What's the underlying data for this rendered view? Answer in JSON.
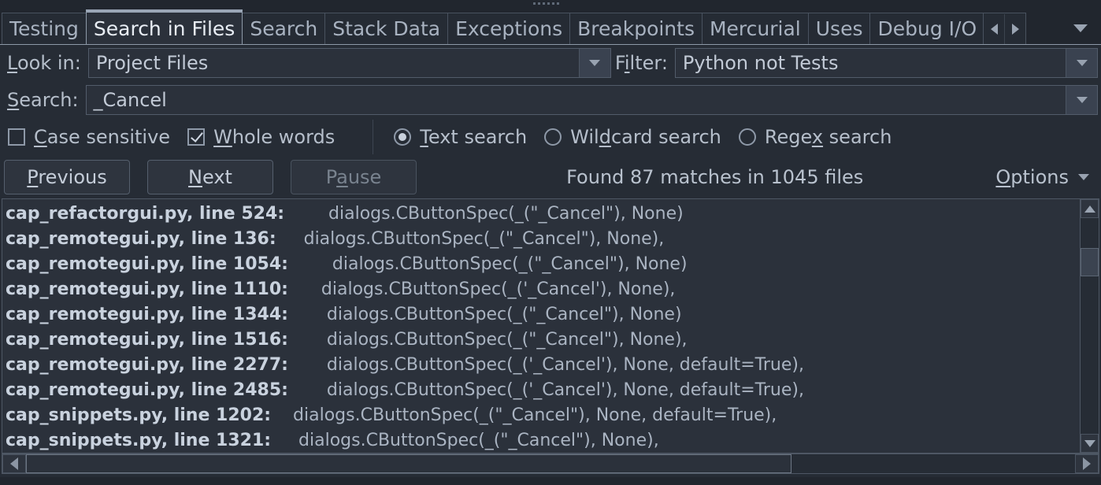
{
  "window": {
    "grip": "drag-grip"
  },
  "tabs": {
    "items": [
      {
        "label": "Testing",
        "active": false
      },
      {
        "label": "Search in Files",
        "active": true
      },
      {
        "label": "Search",
        "active": false
      },
      {
        "label": "Stack Data",
        "active": false
      },
      {
        "label": "Exceptions",
        "active": false
      },
      {
        "label": "Breakpoints",
        "active": false
      },
      {
        "label": "Mercurial",
        "active": false
      },
      {
        "label": "Uses",
        "active": false
      },
      {
        "label": "Debug I/O",
        "active": false
      }
    ],
    "scroll_left_icon": "chevron-left-icon",
    "scroll_right_icon": "chevron-right-icon",
    "menu_icon": "chevron-down-icon"
  },
  "form": {
    "look_in_label_pre": "",
    "look_in_label_mn": "L",
    "look_in_label_post": "ook in:",
    "look_in_value": "Project Files",
    "filter_label_pre": "F",
    "filter_label_mn": "i",
    "filter_label_post": "lter:",
    "filter_value": "Python not Tests",
    "search_label_mn": "S",
    "search_label_post": "earch:",
    "search_value": "_Cancel",
    "dropdown_icon": "chevron-down-icon"
  },
  "options": {
    "case_sensitive": {
      "label_mn": "C",
      "label_post": "ase sensitive",
      "checked": false
    },
    "whole_words": {
      "label_mn": "W",
      "label_post": "hole words",
      "checked": true
    },
    "modes": [
      {
        "pre": "",
        "mn": "T",
        "post": "ext search",
        "selected": true
      },
      {
        "pre": "Wil",
        "mn": "d",
        "post": "card search",
        "selected": false
      },
      {
        "pre": "Rege",
        "mn": "x",
        "post": " search",
        "selected": false
      }
    ]
  },
  "actions": {
    "previous": {
      "mn": "P",
      "post": "revious",
      "disabled": false
    },
    "next": {
      "mn": "N",
      "post": "ext",
      "disabled": false
    },
    "pause": {
      "pre": "P",
      "mn": "a",
      "post": "use",
      "disabled": true
    },
    "status": "Found 87 matches in 1045 files",
    "options": {
      "mn": "O",
      "post": "ptions",
      "icon": "chevron-down-icon"
    }
  },
  "results": {
    "rows": [
      {
        "file": "cap_refactorgui.py, line 524:",
        "code": "        dialogs.CButtonSpec(_(\"_Cancel\"), None)",
        "indent": 0
      },
      {
        "file": "cap_remotegui.py, line 136:",
        "code": "     dialogs.CButtonSpec(_(\"_Cancel\"), None),",
        "indent": 0
      },
      {
        "file": "cap_remotegui.py, line 1054:",
        "code": "        dialogs.CButtonSpec(_(\"_Cancel\"), None)",
        "indent": 0
      },
      {
        "file": "cap_remotegui.py, line 1110:",
        "code": "      dialogs.CButtonSpec(_('_Cancel'), None),",
        "indent": 0
      },
      {
        "file": "cap_remotegui.py, line 1344:",
        "code": "       dialogs.CButtonSpec(_(\"_Cancel\"), None)",
        "indent": 0
      },
      {
        "file": "cap_remotegui.py, line 1516:",
        "code": "       dialogs.CButtonSpec(_(\"_Cancel\"), None),",
        "indent": 0
      },
      {
        "file": "cap_remotegui.py, line 2277:",
        "code": "       dialogs.CButtonSpec(_('_Cancel'), None, default=True),",
        "indent": 0
      },
      {
        "file": "cap_remotegui.py, line 2485:",
        "code": "       dialogs.CButtonSpec(_('_Cancel'), None, default=True),",
        "indent": 0
      },
      {
        "file": "cap_snippets.py, line 1202:",
        "code": "    dialogs.CButtonSpec(_(\"_Cancel\"), None, default=True),",
        "indent": 0
      },
      {
        "file": "cap_snippets.py, line 1321:",
        "code": "     dialogs.CButtonSpec(_(\"_Cancel\"), None),",
        "indent": 0
      }
    ],
    "vscroll": {
      "up_icon": "triangle-up-icon",
      "down_icon": "triangle-down-icon",
      "thumb_top_pct": 14,
      "thumb_height_pct": 13
    },
    "hscroll": {
      "left_icon": "triangle-left-icon",
      "right_icon": "triangle-right-icon",
      "thumb_left_pct": 0,
      "thumb_width_pct": 73
    }
  },
  "colors": {
    "bg": "#21262e",
    "panel": "#262c35",
    "field": "#2b313b",
    "border": "#4e5764",
    "text": "#b8c0cc",
    "text_bright": "#e8edf4"
  }
}
